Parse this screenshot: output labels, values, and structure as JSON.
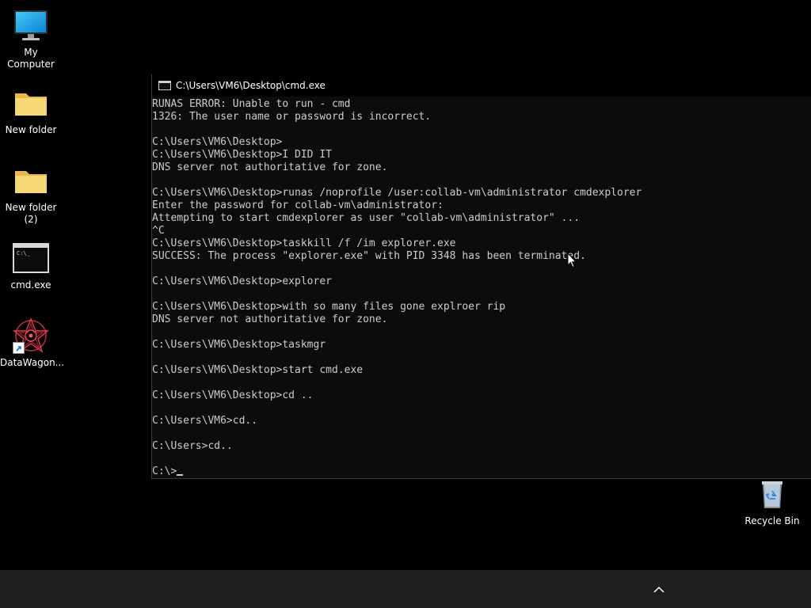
{
  "desktop": {
    "icons": [
      {
        "label": "My Computer"
      },
      {
        "label": "New folder"
      },
      {
        "label": "New folder\n(2)"
      },
      {
        "label": "cmd.exe"
      },
      {
        "label": "DataWagon..."
      },
      {
        "label": "Recycle Bin"
      }
    ]
  },
  "console": {
    "title": "C:\\Users\\VM6\\Desktop\\cmd.exe",
    "lines": [
      "RUNAS ERROR: Unable to run - cmd",
      "1326: The user name or password is incorrect.",
      "",
      "C:\\Users\\VM6\\Desktop>",
      "C:\\Users\\VM6\\Desktop>I DID IT",
      "DNS server not authoritative for zone.",
      "",
      "C:\\Users\\VM6\\Desktop>runas /noprofile /user:collab-vm\\administrator cmdexplorer",
      "Enter the password for collab-vm\\administrator:",
      "Attempting to start cmdexplorer as user \"collab-vm\\administrator\" ...",
      "^C",
      "C:\\Users\\VM6\\Desktop>taskkill /f /im explorer.exe",
      "SUCCESS: The process \"explorer.exe\" with PID 3348 has been terminated.",
      "",
      "C:\\Users\\VM6\\Desktop>explorer",
      "",
      "C:\\Users\\VM6\\Desktop>with so many files gone explroer rip",
      "DNS server not authoritative for zone.",
      "",
      "C:\\Users\\VM6\\Desktop>taskmgr",
      "",
      "C:\\Users\\VM6\\Desktop>start cmd.exe",
      "",
      "C:\\Users\\VM6\\Desktop>cd ..",
      "",
      "C:\\Users\\VM6>cd..",
      "",
      "C:\\Users>cd..",
      ""
    ],
    "prompt": "C:\\>"
  },
  "colors": {
    "desktop_bg": "#000000",
    "console_bg": "#0c0c0c",
    "console_fg": "#cccccc",
    "taskbar_bg": "#1f1f1f"
  },
  "icons": {
    "computer": "monitor-icon",
    "folder": "folder-icon",
    "cmd": "console-icon",
    "datawagon": "star-logo-icon",
    "recycle": "recycle-bin-icon",
    "tray": "chevron-up-icon"
  }
}
